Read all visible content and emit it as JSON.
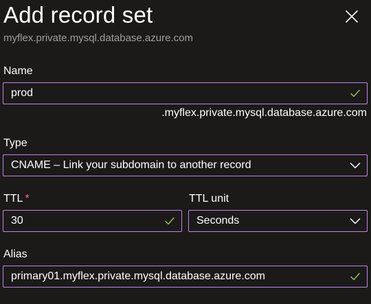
{
  "header": {
    "title": "Add record set",
    "subtitle": "myflex.private.mysql.database.azure.com"
  },
  "form": {
    "name": {
      "label": "Name",
      "value": "prod",
      "suffix": ".myflex.private.mysql.database.azure.com"
    },
    "type": {
      "label": "Type",
      "selected": "CNAME – Link your subdomain to another record"
    },
    "ttl": {
      "label": "TTL",
      "required_marker": "*",
      "value": "30"
    },
    "ttl_unit": {
      "label": "TTL unit",
      "selected": "Seconds"
    },
    "alias": {
      "label": "Alias",
      "value": "primary01.myflex.private.mysql.database.azure.com"
    }
  },
  "icons": {
    "close": "close-icon",
    "valid": "checkmark-icon",
    "dropdown": "chevron-down-icon"
  },
  "colors": {
    "background": "#1b1a19",
    "field_border": "#c384e8",
    "check": "#92c353",
    "required": "#f1707b",
    "subtitle": "#a19f9d"
  }
}
